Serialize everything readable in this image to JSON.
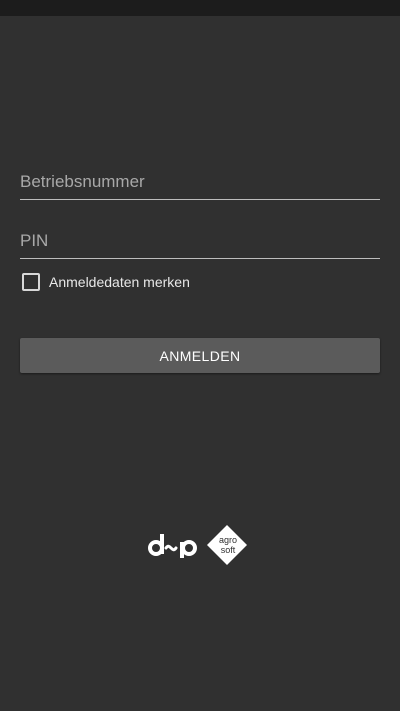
{
  "form": {
    "company_number": {
      "placeholder": "Betriebsnummer",
      "value": ""
    },
    "pin": {
      "placeholder": "PIN",
      "value": ""
    },
    "remember": {
      "label": "Anmeldedaten merken",
      "checked": false
    },
    "login_button": {
      "label": "ANMELDEN"
    }
  },
  "branding": {
    "logo_dp": "d-p",
    "logo_agrosoft_top": "agro",
    "logo_agrosoft_bottom": "soft"
  },
  "colors": {
    "background": "#303030",
    "status_bar": "#1c1c1c",
    "button": "#5b5b5b",
    "text": "#e6e6e6"
  }
}
